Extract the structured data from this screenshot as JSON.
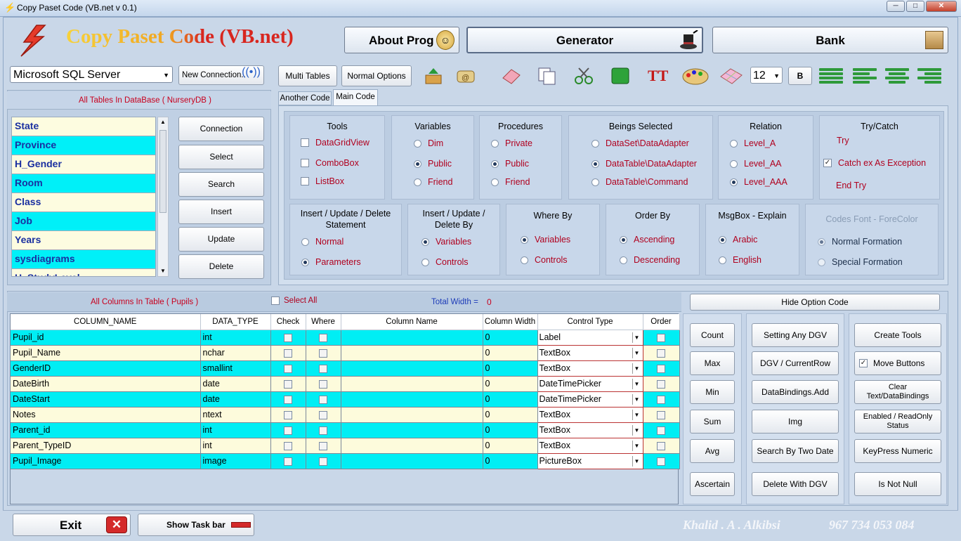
{
  "window": {
    "title": "Copy Paset Code (VB.net  v 0.1)",
    "min": "─",
    "max": "□",
    "close": "✕"
  },
  "header": {
    "app_title": "Copy Paset Code (VB.net)",
    "about": "About Prog",
    "generator": "Generator",
    "bank": "Bank"
  },
  "toolbar": {
    "provider": "Microsoft SQL Server",
    "new_connection": "New Connection..",
    "multi_tables": "Multi Tables",
    "normal_options": "Normal Options",
    "font_size": "12",
    "bold": "B"
  },
  "tables_panel": {
    "title": "All Tables In DataBase ( NurseryDB )",
    "items": [
      "State",
      "Province",
      "H_Gender",
      "Room",
      "Class",
      "Job",
      "Years",
      "sysdiagrams",
      "H_StudyLevel"
    ],
    "buttons": [
      "Connection",
      "Select",
      "Search",
      "Insert",
      "Update",
      "Delete"
    ]
  },
  "tabs": [
    "Another Code",
    "Main Code"
  ],
  "options": {
    "tools": {
      "title": "Tools",
      "items": [
        "DataGridView",
        "ComboBox",
        "ListBox"
      ]
    },
    "variables": {
      "title": "Variables",
      "items": [
        "Dim",
        "Public",
        "Friend"
      ]
    },
    "procedures": {
      "title": "Procedures",
      "items": [
        "Private",
        "Public",
        "Friend"
      ]
    },
    "beings": {
      "title": "Beings Selected",
      "items": [
        "DataSet\\DataAdapter",
        "DataTable\\DataAdapter",
        "DataTable\\Command"
      ]
    },
    "relation": {
      "title": "Relation",
      "items": [
        "Level_A",
        "Level_AA",
        "Level_AAA"
      ]
    },
    "trycatch": {
      "title": "Try/Catch",
      "try": "Try",
      "catch": "Catch ex As Exception",
      "end": "End Try"
    },
    "ius": {
      "title1": "Insert / Update / Delete",
      "title2": "Statement",
      "items": [
        "Normal",
        "Parameters"
      ]
    },
    "iud": {
      "title1": "Insert / Update /",
      "title2": "Delete By",
      "items": [
        "Variables",
        "Controls"
      ]
    },
    "where": {
      "title": "Where By",
      "items": [
        "Variables",
        "Controls"
      ]
    },
    "order": {
      "title": "Order By",
      "items": [
        "Ascending",
        "Descending"
      ]
    },
    "msgbox": {
      "title": "MsgBox - Explain",
      "items": [
        "Arabic",
        "English"
      ]
    },
    "codes_font": {
      "title": "Codes Font - ForeColor",
      "items": [
        "Normal Formation",
        "Special Formation"
      ]
    }
  },
  "columns_panel": {
    "title": "All Columns In Table ( Pupils )",
    "select_all": "Select All",
    "total_width_label": "Total Width =",
    "total_width": "0",
    "hide_option": "Hide Option Code"
  },
  "grid": {
    "headers": [
      "COLUMN_NAME",
      "DATA_TYPE",
      "Check",
      "Where",
      "Column Name",
      "Column Width",
      "Control Type",
      "Order"
    ],
    "rows": [
      {
        "name": "Pupil_id",
        "type": "int",
        "width": "0",
        "control": "Label"
      },
      {
        "name": "Pupil_Name",
        "type": "nchar",
        "width": "0",
        "control": "TextBox"
      },
      {
        "name": "GenderID",
        "type": "smallint",
        "width": "0",
        "control": "TextBox"
      },
      {
        "name": "DateBirth",
        "type": "date",
        "width": "0",
        "control": "DateTimePicker"
      },
      {
        "name": "DateStart",
        "type": "date",
        "width": "0",
        "control": "DateTimePicker"
      },
      {
        "name": "Notes",
        "type": "ntext",
        "width": "0",
        "control": "TextBox"
      },
      {
        "name": "Parent_id",
        "type": "int",
        "width": "0",
        "control": "TextBox"
      },
      {
        "name": "Parent_TypeID",
        "type": "int",
        "width": "0",
        "control": "TextBox"
      },
      {
        "name": "Pupil_Image",
        "type": "image",
        "width": "0",
        "control": "PictureBox"
      }
    ]
  },
  "agg_buttons": [
    "Count",
    "Max",
    "Min",
    "Sum",
    "Avg",
    "Ascertain"
  ],
  "dgv_buttons": [
    "Setting Any DGV",
    "DGV / CurrentRow",
    "DataBindings.Add",
    "Img",
    "Search By Two Date",
    "Delete With DGV"
  ],
  "tool_buttons": {
    "create_tools": "Create Tools",
    "move_buttons": "Move Buttons",
    "clear1": "Clear",
    "clear2": "Text/DataBindings",
    "enabled1": "Enabled / ReadOnly",
    "enabled2": "Status",
    "keypress": "KeyPress Numeric",
    "not_null": "Is Not Null"
  },
  "footer": {
    "exit": "Exit",
    "show_taskbar": "Show Task bar",
    "author": "Khalid . A . Alkibsi",
    "phone": "967 734 053 084"
  }
}
